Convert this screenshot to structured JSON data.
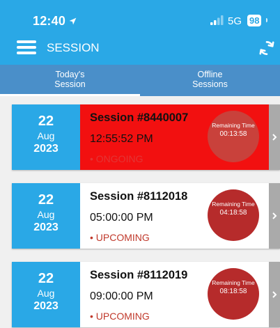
{
  "status_bar": {
    "time": "12:40",
    "network": "5G",
    "battery": "98"
  },
  "toolbar": {
    "title": "SESSION"
  },
  "tabs": [
    {
      "label_line1": "Today's",
      "label_line2": "Session",
      "active": true
    },
    {
      "label_line1": "Offline",
      "label_line2": "Sessions",
      "active": false
    }
  ],
  "sessions": [
    {
      "day": "22",
      "month": "Aug",
      "year": "2023",
      "title": "Session #8440007",
      "time": "12:55:52 PM",
      "status": "• ONGOING",
      "remaining_label": "Remaining Time",
      "remaining_value": "00:13:58"
    },
    {
      "day": "22",
      "month": "Aug",
      "year": "2023",
      "title": "Session #8112018",
      "time": "05:00:00 PM",
      "status": "• UPCOMING",
      "remaining_label": "Remaining Time",
      "remaining_value": "04:18:58"
    },
    {
      "day": "22",
      "month": "Aug",
      "year": "2023",
      "title": "Session #8112019",
      "time": "09:00:00 PM",
      "status": "• UPCOMING",
      "remaining_label": "Remaining Time",
      "remaining_value": "08:18:58"
    }
  ],
  "colors": {
    "header": "#2aa8e6",
    "tabs": "#4a8fc9",
    "live_card": "#f21010",
    "timer_circle": "#b62b2b",
    "chevron_strip": "#aaaaaa"
  },
  "icons": {
    "location": "location-arrow-icon",
    "signal": "signal-bars-icon",
    "menu": "hamburger-menu-icon",
    "sync": "sync-icon",
    "chevron": "chevron-right-icon"
  }
}
